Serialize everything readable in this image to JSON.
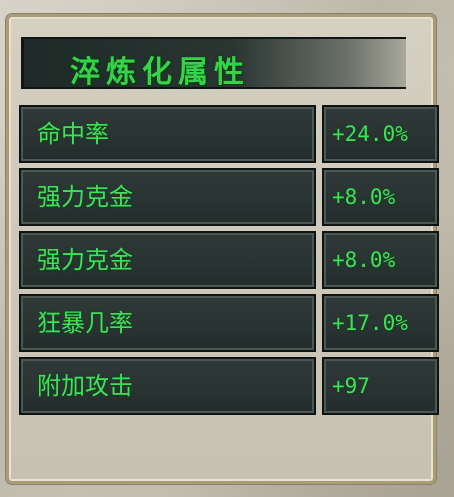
{
  "panel": {
    "title": "淬炼化属性"
  },
  "attributes": [
    {
      "name": "命中率",
      "value": "+24.0%"
    },
    {
      "name": "强力克金",
      "value": "+8.0%"
    },
    {
      "name": "强力克金",
      "value": "+8.0%"
    },
    {
      "name": "狂暴几率",
      "value": "+17.0%"
    },
    {
      "name": "附加攻击",
      "value": "+97"
    }
  ],
  "colors": {
    "text_green": "#3fe05a",
    "cell_dark": "#2b3634",
    "frame_gold": "#a89c79"
  }
}
